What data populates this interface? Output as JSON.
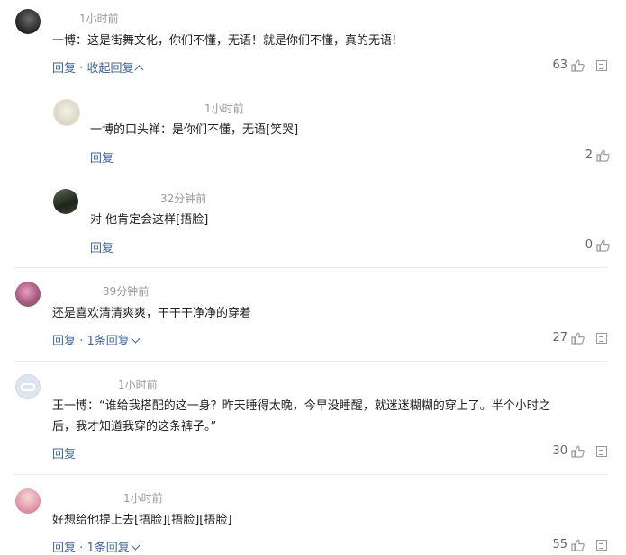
{
  "comments": [
    {
      "time": "1小时前",
      "text": "一博：这是街舞文化，你们不懂，无语！就是你们不懂，真的无语！",
      "reply": "回复",
      "toggle": "收起回复",
      "likes": "63",
      "replies": [
        {
          "time": "1小时前",
          "text": "一博的口头禅：是你们不懂，无语[笑哭]",
          "reply": "回复",
          "likes": "2"
        },
        {
          "time": "32分钟前",
          "text": "对 他肯定会这样[捂脸]",
          "reply": "回复",
          "likes": "0"
        }
      ]
    },
    {
      "time": "39分钟前",
      "text": "还是喜欢清清爽爽，干干干净净的穿着",
      "reply": "回复",
      "toggle": "1条回复",
      "likes": "27"
    },
    {
      "time": "1小时前",
      "text_line1": "王一博：“谁给我搭配的这一身？昨天睡得太晚，今早没睡醒，就迷迷糊糊的穿上了。半个小时之",
      "text_line2": "后，我才知道我穿的这条裤子。”",
      "reply": "回复",
      "likes": "30"
    },
    {
      "time": "1小时前",
      "text": "好想给他提上去[捂脸][捂脸][捂脸]",
      "reply": "回复",
      "toggle": "1条回复",
      "likes": "55"
    }
  ],
  "separator": "·",
  "icons": {
    "like": "thumbs-up-icon",
    "more": "more-options-icon"
  },
  "colors": {
    "link": "#406599",
    "meta": "#999999",
    "count": "#666666"
  }
}
